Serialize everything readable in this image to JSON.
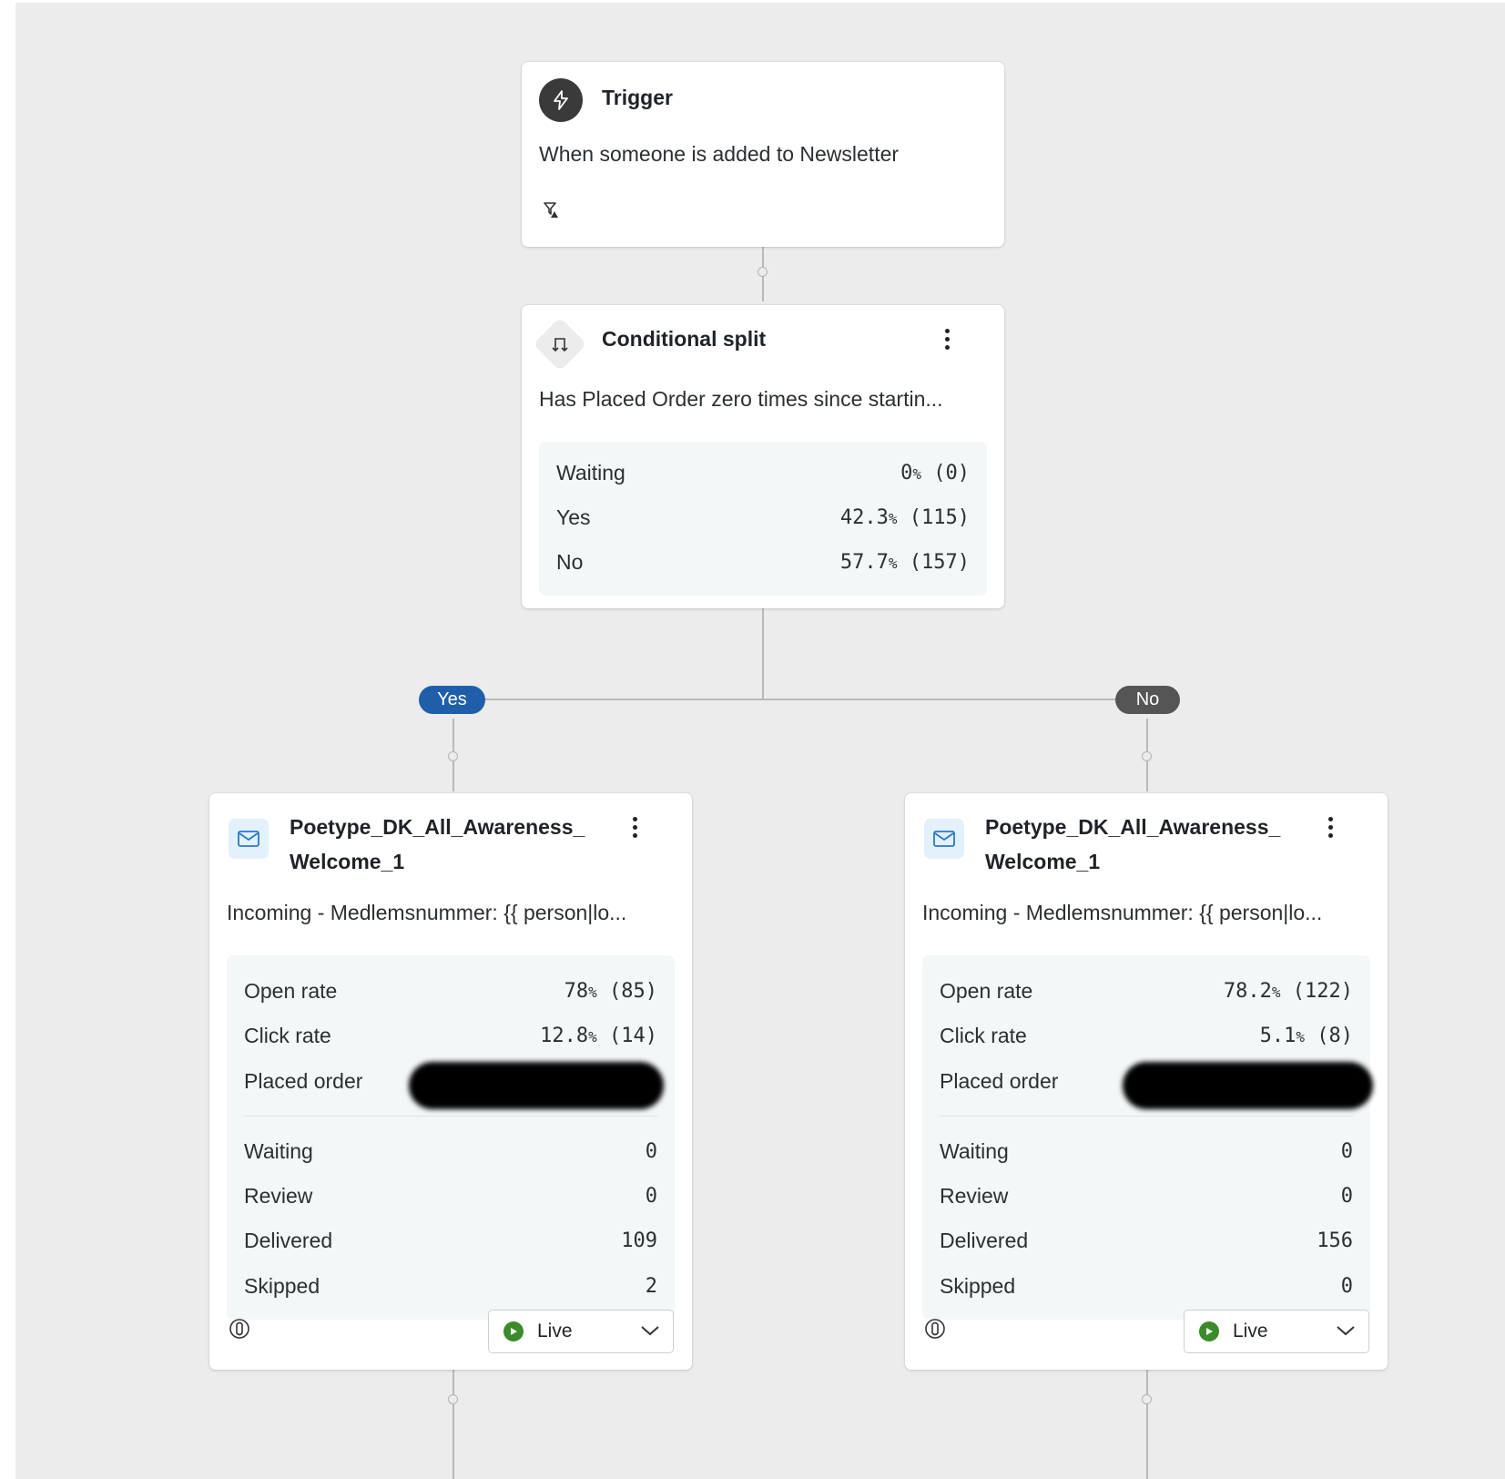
{
  "trigger": {
    "title": "Trigger",
    "description": "When someone is added to Newsletter"
  },
  "split": {
    "title": "Conditional split",
    "description": "Has Placed Order zero times since startin...",
    "stats": [
      {
        "label": "Waiting",
        "value": "0",
        "pct": "%",
        "count": " (0)"
      },
      {
        "label": "Yes",
        "value": "42.3",
        "pct": "%",
        "count": " (115)"
      },
      {
        "label": "No",
        "value": "57.7",
        "pct": "%",
        "count": " (157)"
      }
    ]
  },
  "branches": {
    "yes_label": "Yes",
    "no_label": "No"
  },
  "email_left": {
    "title_line1": "Poetype_DK_All_Awareness_",
    "title_line2": "Welcome_1",
    "description": "Incoming - Medlemsnummer: {{ person|lo...",
    "open_rate": {
      "label": "Open rate",
      "value": "78",
      "pct": "%",
      "count": " (85)"
    },
    "click_rate": {
      "label": "Click rate",
      "value": "12.8",
      "pct": "%",
      "count": " (14)"
    },
    "placed_order": {
      "label": "Placed order"
    },
    "waiting": {
      "label": "Waiting",
      "value": "0"
    },
    "review": {
      "label": "Review",
      "value": "0"
    },
    "delivered": {
      "label": "Delivered",
      "value": "109"
    },
    "skipped": {
      "label": "Skipped",
      "value": "2"
    },
    "status": "Live"
  },
  "email_right": {
    "title_line1": "Poetype_DK_All_Awareness_",
    "title_line2": "Welcome_1",
    "description": "Incoming - Medlemsnummer: {{ person|lo...",
    "open_rate": {
      "label": "Open rate",
      "value": "78.2",
      "pct": "%",
      "count": " (122)"
    },
    "click_rate": {
      "label": "Click rate",
      "value": "5.1",
      "pct": "%",
      "count": " (8)"
    },
    "placed_order": {
      "label": "Placed order"
    },
    "waiting": {
      "label": "Waiting",
      "value": "0"
    },
    "review": {
      "label": "Review",
      "value": "0"
    },
    "delivered": {
      "label": "Delivered",
      "value": "156"
    },
    "skipped": {
      "label": "Skipped",
      "value": "0"
    },
    "status": "Live"
  },
  "colors": {
    "canvas": "#ececec",
    "yes_pill": "#1f5fa9",
    "no_pill": "#555555",
    "live": "#3b8b2a",
    "email_icon_bg": "#e2f1fb"
  }
}
